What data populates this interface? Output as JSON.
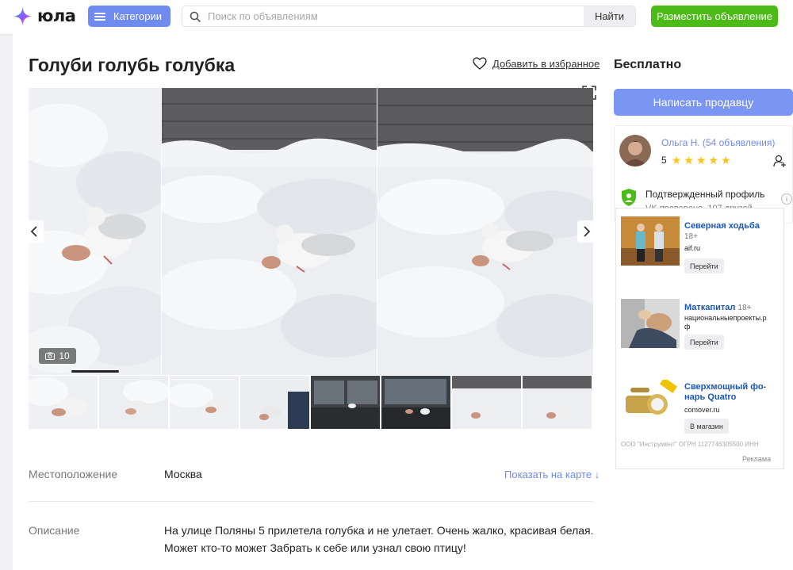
{
  "header": {
    "logo_text": "юла",
    "categories_label": "Категории",
    "search_placeholder": "Поиск по объявлениям",
    "search_button": "Найти",
    "post_button": "Разместить объявление"
  },
  "listing": {
    "title": "Голуби голубь голубка",
    "favorite_label": "Добавить в избранное",
    "photo_count": "10",
    "location_label": "Местоположение",
    "location_value": "Москва",
    "map_link": "Показать на карте ↓",
    "description_label": "Описание",
    "description": "На улице Поляны 5 прилетела голубка и не улетает. Очень жалко, красивая белая. Может кто-то может Забрать к себе или узнал свою птицу!"
  },
  "sidebar": {
    "price": "Бесплатно",
    "write_button": "Написать продавцу",
    "seller_name": "Ольга Н. (54 объявления)",
    "rating_value": "5",
    "stars": 5,
    "verified_title": "Подтвержденный профиль",
    "verified_sub": "VK проверено, 107 друзей",
    "info_icon": "i"
  },
  "ads": {
    "items": [
      {
        "title": "Северная ходьба",
        "age": "18+",
        "domain": "aif.ru",
        "button": "Перейти"
      },
      {
        "title": "Маткапитал",
        "age": "18+",
        "domain": "национальныепроекты.рф",
        "button": "Перейти"
      },
      {
        "title": "Сверхмощный фо-нарь Quatro",
        "age": "",
        "domain": "comover.ru",
        "button": "В магазин"
      }
    ],
    "legal": "ООО \"Инструмент\" ОГРН 1127746305500 ИНН",
    "label": "Реклама"
  },
  "colors": {
    "accent": "#6f8bf0",
    "green": "#4cbb17",
    "star": "#ffc21a"
  }
}
